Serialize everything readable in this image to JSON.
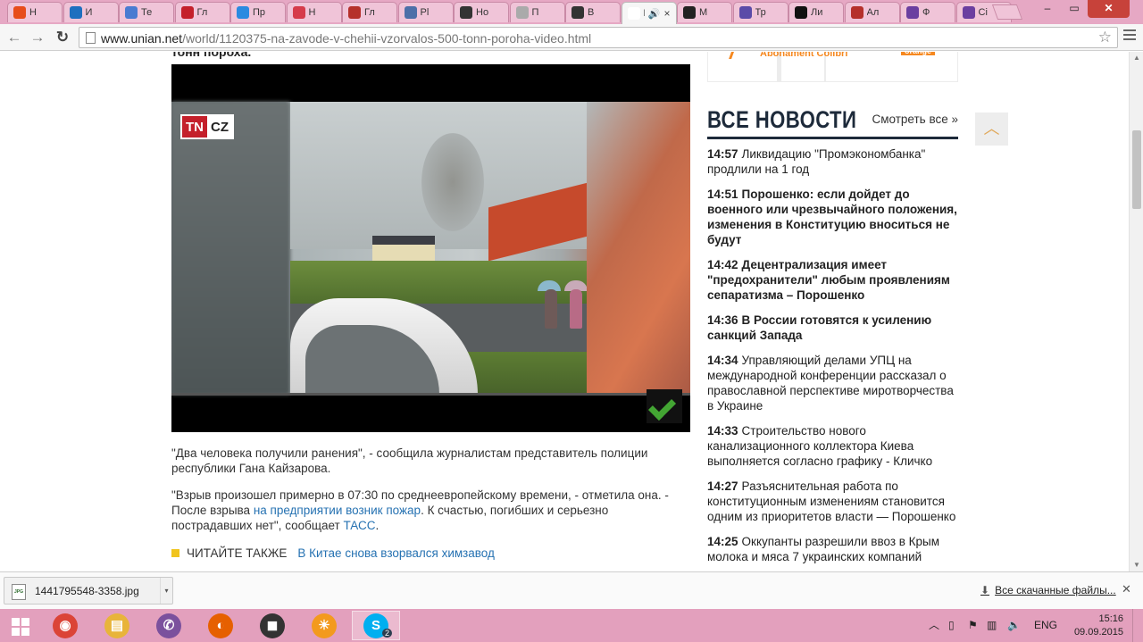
{
  "browser": {
    "tabs": [
      {
        "label": "Н",
        "favicon_color": "#e74c1b",
        "icon": "browser-favicon-icon"
      },
      {
        "label": "И",
        "favicon_color": "#1e6fbf",
        "icon": "f-icon"
      },
      {
        "label": "Те",
        "favicon_color": "#4a7bd1",
        "icon": "leaf-icon"
      },
      {
        "label": "Гл",
        "favicon_color": "#c4202b",
        "icon": "star-icon"
      },
      {
        "label": "Пр",
        "favicon_color": "#2b8ae0",
        "icon": "globe-icon"
      },
      {
        "label": "Н",
        "favicon_color": "#d63b4b",
        "icon": "s-icon"
      },
      {
        "label": "Гл",
        "favicon_color": "#b5302b",
        "icon": "t-icon"
      },
      {
        "label": "Pl",
        "favicon_color": "#4d6fa8",
        "icon": "planet-icon"
      },
      {
        "label": "Но",
        "favicon_color": "#333333",
        "icon": "window-icon"
      },
      {
        "label": "П",
        "favicon_color": "#aaaaaa",
        "icon": "dot-icon"
      },
      {
        "label": "В",
        "favicon_color": "#333333",
        "icon": "window-icon"
      },
      {
        "label": "Н",
        "favicon_color": "#ffffff",
        "icon": "speaker-icon",
        "active": true,
        "audio": "🔊",
        "close": "×"
      },
      {
        "label": "М",
        "favicon_color": "#222222",
        "icon": "l-icon"
      },
      {
        "label": "Тр",
        "favicon_color": "#5b4ba8",
        "icon": "tj-icon"
      },
      {
        "label": "Ли",
        "favicon_color": "#111111",
        "icon": "ink-icon"
      },
      {
        "label": "Ал",
        "favicon_color": "#b5302b",
        "icon": "a-icon"
      },
      {
        "label": "Ф",
        "favicon_color": "#6b3fa0",
        "icon": "circle-icon"
      },
      {
        "label": "Сі",
        "favicon_color": "#6b3fa0",
        "icon": "circle-icon"
      }
    ],
    "window_controls": {
      "minimize": "–",
      "maximize": "▭",
      "close": "✕"
    },
    "url_host": "www.unian.net",
    "url_path": "/world/1120375-na-zavode-v-chehii-vzorvalos-500-tonn-poroha-video.html",
    "back": "←",
    "forward": "→",
    "reload": "↻",
    "star": "☆"
  },
  "article": {
    "cutoff_text": "тонн пороха.",
    "video": {
      "logo_left": "TN",
      "logo_right": "CZ"
    },
    "paragraph_1": "\"Два человека получили ранения\", - сообщила журналистам представитель полиции республики Гана Кайзарова.",
    "paragraph_2_a": "\"Взрыв произошел примерно в 07:30 по среднеевропейскому времени, - отметила она. - После взрыва ",
    "paragraph_2_link1": "на предприятии возник пожар",
    "paragraph_2_b": ". К счастью, погибших и серьезно пострадавших нет\", сообщает ",
    "paragraph_2_link2": "ТАСС",
    "paragraph_2_c": ".",
    "read_also_label": "ЧИТАЙТЕ ТАКЖЕ",
    "read_also_link": "В Китае снова взорвался химзавод"
  },
  "sidebar": {
    "ad_text": "Abonament Colibri",
    "ad_badge": "orange",
    "news_title": "ВСЕ НОВОСТИ",
    "news_all": "Смотреть все »",
    "scroll_top": "︿",
    "items": [
      {
        "time": "14:57",
        "text": "Ликвидацию \"Промэкономбанка\" продлили на 1 год",
        "style": "normal"
      },
      {
        "time": "14:51",
        "text": "Порошенко: если дойдет до военного или чрезвычайного положения, изменения в Конституцию вноситься не будут",
        "style": "bold"
      },
      {
        "time": "14:42",
        "text": "Децентрализация имеет \"предохранители\" любым проявлениям сепаратизма – Порошенко",
        "style": "bold"
      },
      {
        "time": "14:36",
        "text": "В России готовятся к усилению санкций Запада",
        "style": "bold"
      },
      {
        "time": "14:34",
        "text": "Управляющий делами УПЦ на международной конференции рассказал о православной перспективе миротворчества в Украине",
        "style": "normal"
      },
      {
        "time": "14:33",
        "text": "Строительство нового канализационного коллектора Киева выполняется согласно графику - Кличко",
        "style": "normal"
      },
      {
        "time": "14:27",
        "text": "Разъяснительная работа по конституционным изменениям становится одним из приоритетов власти — Порошенко",
        "style": "normal"
      },
      {
        "time": "14:25",
        "text": "Оккупанты разрешили ввоз в Крым молока и мяса 7 украинских компаний",
        "style": "normal"
      }
    ]
  },
  "downloads": {
    "file_name": "1441795548-3358.jpg",
    "file_type": "JPG",
    "dropdown": "▾",
    "all_label": "Все скачанные файлы...",
    "close": "✕"
  },
  "taskbar": {
    "apps": [
      {
        "name": "chrome",
        "color": "#db4437",
        "glyph": "◉",
        "active": false
      },
      {
        "name": "explorer",
        "color": "#e8b43a",
        "glyph": "▤",
        "active": false
      },
      {
        "name": "viber",
        "color": "#7b519d",
        "glyph": "✆",
        "active": false
      },
      {
        "name": "firefox",
        "color": "#e66000",
        "glyph": "◐",
        "active": false
      },
      {
        "name": "camera",
        "color": "#333333",
        "glyph": "◼",
        "active": false
      },
      {
        "name": "sun-app",
        "color": "#f39a1e",
        "glyph": "☀",
        "active": false
      },
      {
        "name": "skype",
        "color": "#00aff0",
        "glyph": "S",
        "active": true,
        "badge": "2"
      }
    ],
    "language": "ENG",
    "time": "15:16",
    "date": "09.09.2015"
  }
}
